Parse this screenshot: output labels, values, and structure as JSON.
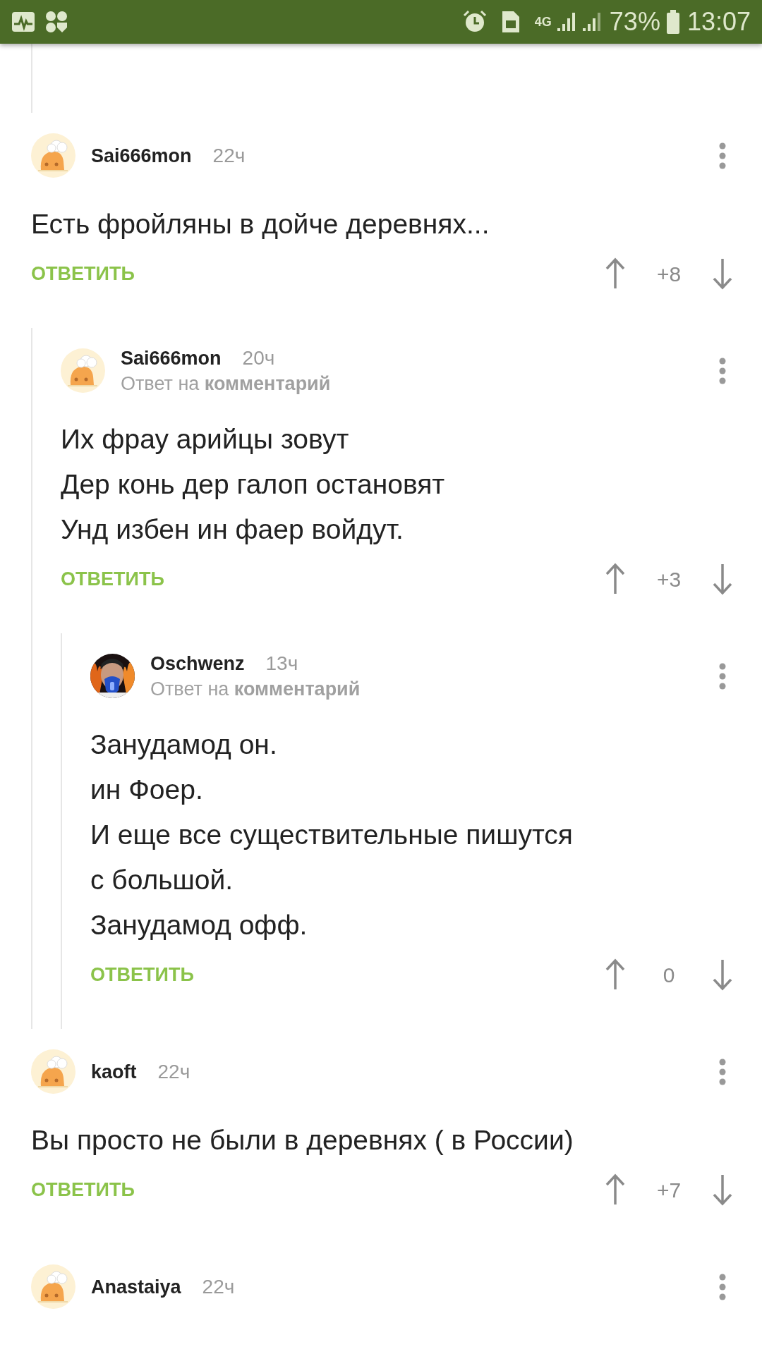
{
  "status_bar": {
    "network": "4G",
    "battery": "73%",
    "time": "13:07"
  },
  "comments": [
    {
      "author": "Sai666mon",
      "time": "22ч",
      "avatar": {
        "kind": "default"
      },
      "lines": [
        "Есть фройляны в дойче деревнях..."
      ],
      "reply": "ОТВЕТИТЬ",
      "votes": "+8",
      "children": [
        {
          "author": "Sai666mon",
          "time": "20ч",
          "avatar": {
            "kind": "default"
          },
          "reply_to": "Ответ на **комментарий**",
          "lines": [
            "Их фрау арийцы зовут",
            "Дер конь дер галоп остановят",
            "Унд избен ин фаер войдут."
          ],
          "reply": "ОТВЕТИТЬ",
          "votes": "+3",
          "children": [
            {
              "author": "Oschwenz",
              "time": "13ч",
              "reply_to": "Ответ на **комментарий**",
              "lines": [
                "Занудамод он.",
                "ин Фоер.",
                "И еще все существительные пишутся",
                "с большой.",
                "Занудамод офф."
              ],
              "reply": "ОТВЕТИТЬ",
              "votes": "0"
            }
          ]
        }
      ]
    },
    {
      "author": "kaoft",
      "time": "22ч",
      "avatar": {
        "kind": "default"
      },
      "lines": [
        "Вы просто не были в деревнях ( в России)"
      ],
      "reply": "ОТВЕТИТЬ",
      "votes": "+7"
    },
    {
      "author": "Anastaiya",
      "time": "22ч",
      "avatar": {
        "kind": "default"
      }
    }
  ]
}
